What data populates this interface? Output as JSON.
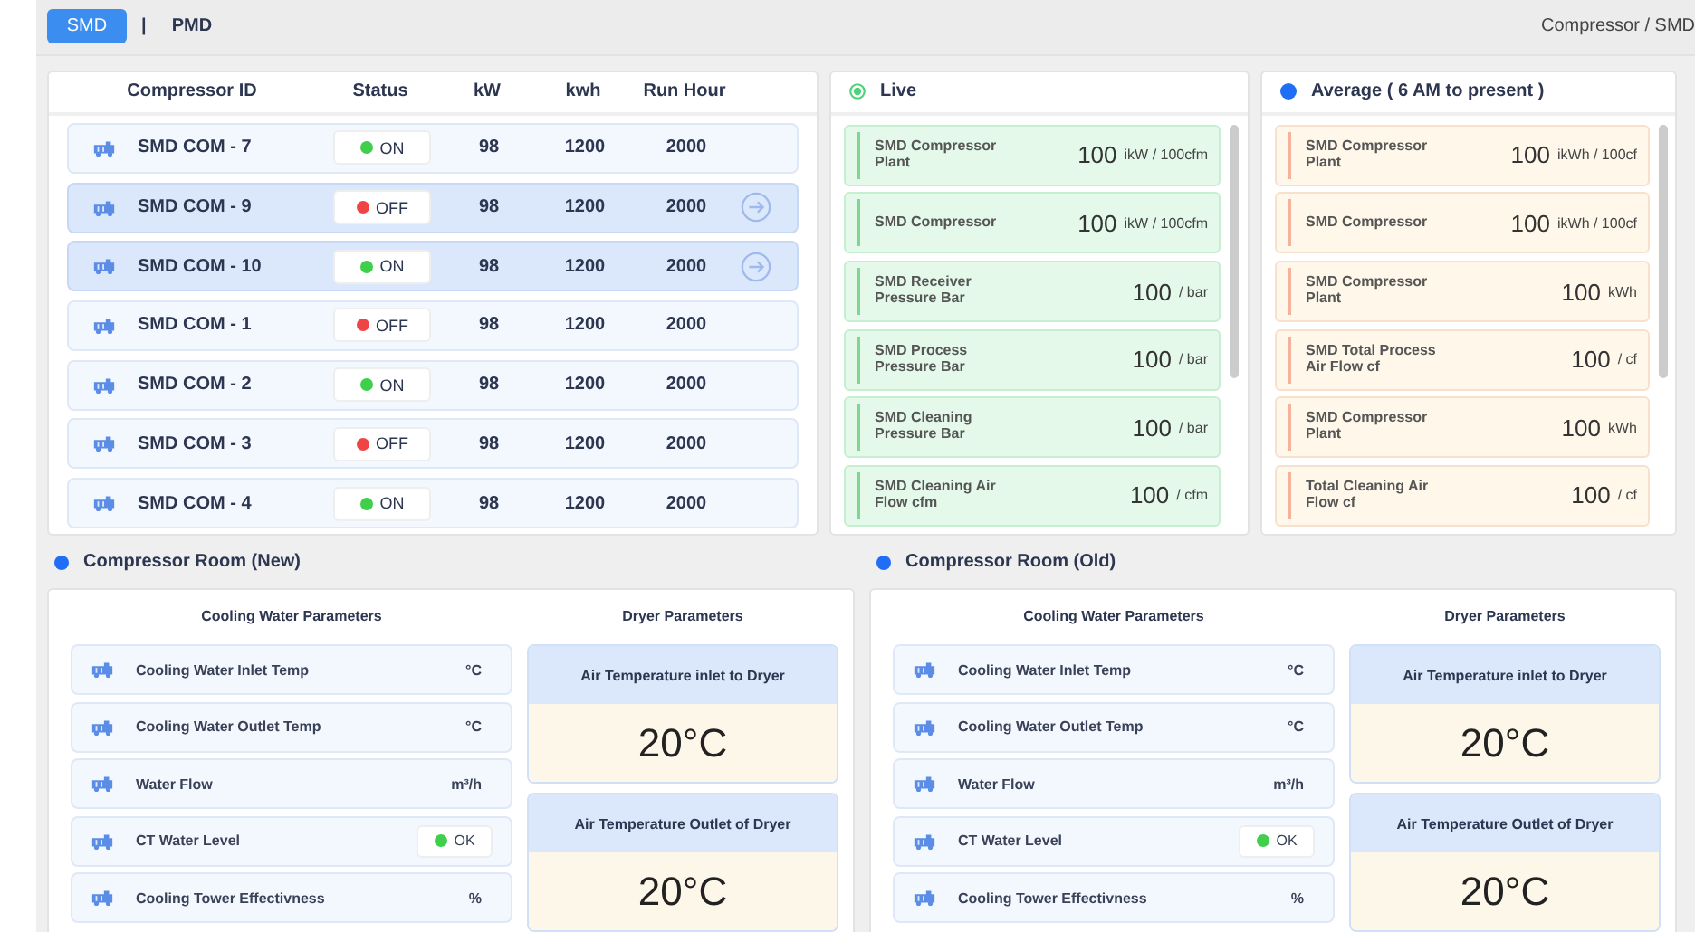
{
  "tabs": [
    {
      "label": "SMD",
      "selected": true
    },
    {
      "label": "PMD",
      "selected": false
    }
  ],
  "tab_separator": "|",
  "breadcrumb": "Compressor / SMD",
  "compressor_table": {
    "columns": [
      "Compressor ID",
      "Status",
      "kW",
      "kwh",
      "Run Hour"
    ],
    "rows": [
      {
        "id": "SMD COM - 7",
        "status": "ON",
        "running": true,
        "kw": "98",
        "kwh": "1200",
        "run_hour": "2000",
        "selected": false
      },
      {
        "id": "SMD COM - 9",
        "status": "OFF",
        "running": false,
        "kw": "98",
        "kwh": "1200",
        "run_hour": "2000",
        "selected": true
      },
      {
        "id": "SMD COM - 10",
        "status": "ON",
        "running": true,
        "kw": "98",
        "kwh": "1200",
        "run_hour": "2000",
        "selected": true
      },
      {
        "id": "SMD COM - 1",
        "status": "OFF",
        "running": false,
        "kw": "98",
        "kwh": "1200",
        "run_hour": "2000",
        "selected": false
      },
      {
        "id": "SMD COM - 2",
        "status": "ON",
        "running": true,
        "kw": "98",
        "kwh": "1200",
        "run_hour": "2000",
        "selected": false
      },
      {
        "id": "SMD COM - 3",
        "status": "OFF",
        "running": false,
        "kw": "98",
        "kwh": "1200",
        "run_hour": "2000",
        "selected": false
      },
      {
        "id": "SMD COM - 4",
        "status": "ON",
        "running": true,
        "kw": "98",
        "kwh": "1200",
        "run_hour": "2000",
        "selected": false
      }
    ]
  },
  "panels": [
    {
      "kind": "live",
      "title": "Live",
      "items": [
        {
          "label": "SMD Compressor Plant",
          "value": "100",
          "unit": "ikW / 100cfm"
        },
        {
          "label": "SMD Compressor",
          "value": "100",
          "unit": "ikW / 100cfm"
        },
        {
          "label": "SMD Receiver Pressure Bar",
          "value": "100",
          "unit": "/ bar"
        },
        {
          "label": "SMD Process Pressure Bar",
          "value": "100",
          "unit": "/ bar"
        },
        {
          "label": "SMD Cleaning Pressure Bar",
          "value": "100",
          "unit": "/ bar"
        },
        {
          "label": "SMD Cleaning Air Flow cfm",
          "value": "100",
          "unit": "/ cfm"
        }
      ]
    },
    {
      "kind": "average",
      "title": "Average ( 6 AM to present )",
      "items": [
        {
          "label": "SMD Compressor Plant",
          "value": "100",
          "unit": "ikWh / 100cf"
        },
        {
          "label": "SMD Compressor",
          "value": "100",
          "unit": "ikWh / 100cf"
        },
        {
          "label": "SMD Compressor Plant",
          "value": "100",
          "unit": "kWh"
        },
        {
          "label": "SMD Total Process Air Flow cf",
          "value": "100",
          "unit": "/ cf"
        },
        {
          "label": "SMD Compressor Plant",
          "value": "100",
          "unit": "kWh"
        },
        {
          "label": "Total Cleaning Air Flow cf",
          "value": "100",
          "unit": "/ cf"
        }
      ]
    }
  ],
  "rooms": [
    {
      "title": "Compressor Room (New)",
      "cooling_title": "Cooling Water Parameters",
      "dryer_title": "Dryer Parameters",
      "parameters": [
        {
          "kind": "unit",
          "label": "Cooling Water Inlet Temp",
          "unit": "°C"
        },
        {
          "kind": "unit",
          "label": "Cooling Water Outlet Temp",
          "unit": "°C"
        },
        {
          "kind": "unit",
          "label": "Water Flow",
          "unit": "m³/h"
        },
        {
          "kind": "status",
          "label": "CT Water Level",
          "status": "OK",
          "ok": true
        },
        {
          "kind": "unit",
          "label": "Cooling Tower Effectivness",
          "unit": "%"
        }
      ],
      "dryer": [
        {
          "label": "Air Temperature inlet to Dryer",
          "value": "20°C"
        },
        {
          "label": "Air Temperature Outlet of Dryer",
          "value": "20°C"
        }
      ]
    },
    {
      "title": "Compressor Room (Old)",
      "cooling_title": "Cooling Water Parameters",
      "dryer_title": "Dryer Parameters",
      "parameters": [
        {
          "kind": "unit",
          "label": "Cooling Water Inlet Temp",
          "unit": "°C"
        },
        {
          "kind": "unit",
          "label": "Cooling Water Outlet Temp",
          "unit": "°C"
        },
        {
          "kind": "unit",
          "label": "Water Flow",
          "unit": "m³/h"
        },
        {
          "kind": "status",
          "label": "CT Water Level",
          "status": "OK",
          "ok": true
        },
        {
          "kind": "unit",
          "label": "Cooling Tower Effectivness",
          "unit": "%"
        }
      ],
      "dryer": [
        {
          "label": "Air Temperature inlet to Dryer",
          "value": "20°C"
        },
        {
          "label": "Air Temperature Outlet of Dryer",
          "value": "20°C"
        }
      ]
    }
  ]
}
